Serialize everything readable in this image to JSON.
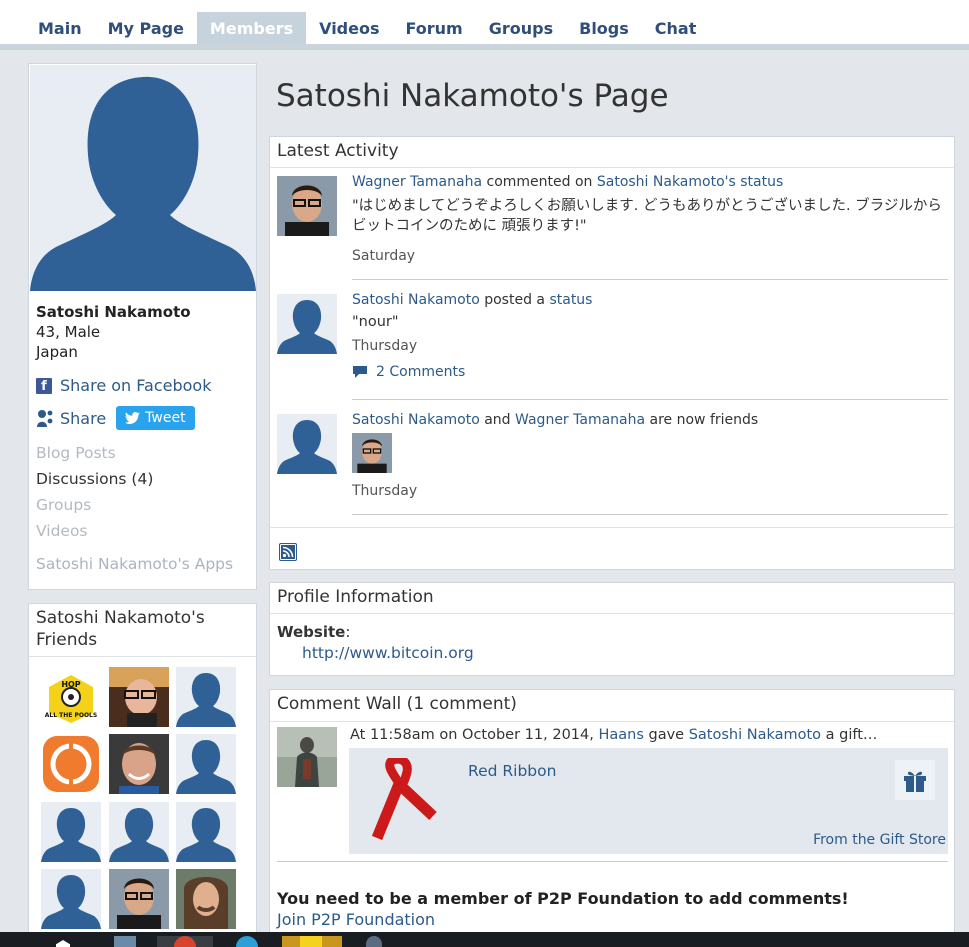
{
  "nav": {
    "tabs": [
      {
        "label": "Main"
      },
      {
        "label": "My Page"
      },
      {
        "label": "Members"
      },
      {
        "label": "Videos"
      },
      {
        "label": "Forum"
      },
      {
        "label": "Groups"
      },
      {
        "label": "Blogs"
      },
      {
        "label": "Chat"
      }
    ],
    "active_index": 2
  },
  "profile": {
    "name": "Satoshi Nakamoto",
    "age_gender": "43, Male",
    "location": "Japan",
    "share_facebook": "Share on Facebook",
    "share": "Share",
    "tweet": "Tweet",
    "links": {
      "blog_posts": "Blog Posts",
      "discussions": "Discussions (4)",
      "groups": "Groups",
      "videos": "Videos",
      "apps": "Satoshi Nakamoto's Apps"
    }
  },
  "friends": {
    "title": "Satoshi Nakamoto's Friends",
    "badge_logo_text": "HOP ALL THE POOLS"
  },
  "page_title": "Satoshi Nakamoto's Page",
  "activity": {
    "title": "Latest Activity",
    "items": [
      {
        "actor": "Wagner Tamanaha",
        "verb": " commented on ",
        "target": "Satoshi Nakamoto's status",
        "text": "\"はじめましてどうぞよろしくお願いします. どうもありがとうございました. ブラジルからビットコインのために 頑張ります!\"",
        "when": "Saturday"
      },
      {
        "actor": "Satoshi Nakamoto",
        "verb": " posted a ",
        "target": "status",
        "text": "\"nour\"",
        "when": "Thursday",
        "comments": "2 Comments"
      },
      {
        "actor": "Satoshi Nakamoto",
        "verb": " and ",
        "target": "Wagner Tamanaha",
        "suffix": " are now friends",
        "when": "Thursday"
      }
    ]
  },
  "profile_info": {
    "title": "Profile Information",
    "website_label": "Website",
    "website_colon": ":",
    "website_url": "http://www.bitcoin.org"
  },
  "comment_wall": {
    "title": "Comment Wall (1 comment)",
    "prefix": "At 11:58am on October 11, 2014, ",
    "actor": "Haans",
    "verb": " gave ",
    "target": "Satoshi Nakamoto",
    "suffix": " a gift…",
    "gift_name": "Red Ribbon",
    "gift_store": "From the Gift Store",
    "member_notice": "You need to be a member of P2P Foundation to add comments!",
    "join": "Join P2P Foundation"
  },
  "colors": {
    "avatar": "#2f6197",
    "link": "#2c5a8a",
    "nav_active": "#c6d3dc",
    "tweet": "#2aa3ef",
    "ribbon": "#cc1a1a"
  }
}
